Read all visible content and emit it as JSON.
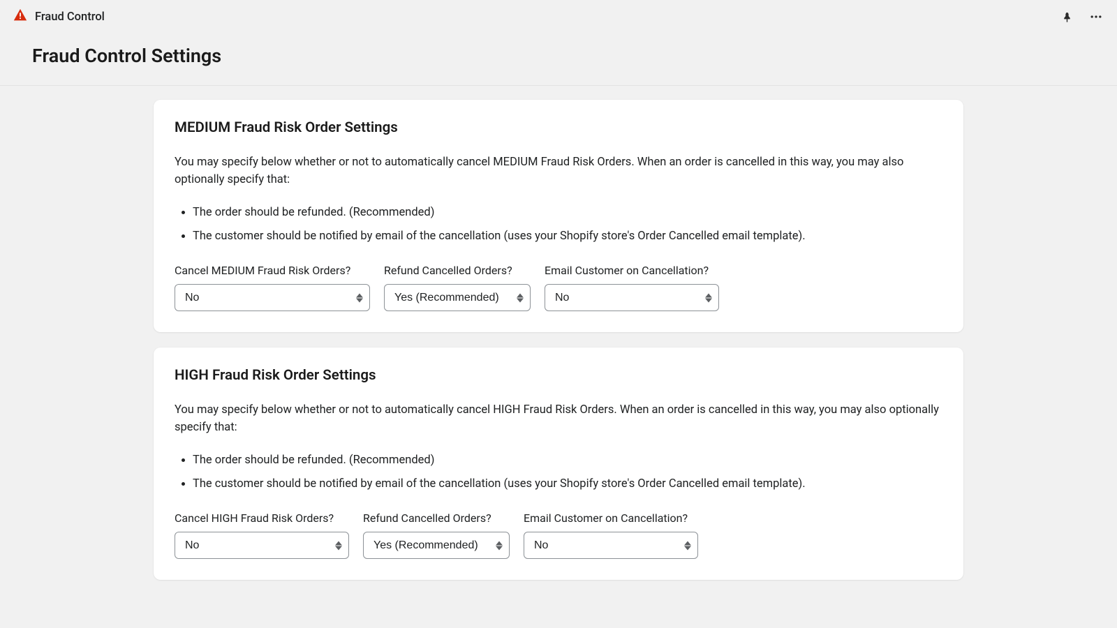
{
  "topbar": {
    "appTitle": "Fraud Control"
  },
  "pageTitle": "Fraud Control Settings",
  "sectionMedium": {
    "title": "MEDIUM Fraud Risk Order Settings",
    "description": "You may specify below whether or not to automatically cancel MEDIUM Fraud Risk Orders. When an order is cancelled in this way, you may also optionally specify that:",
    "bullets": [
      "The order should be refunded. (Recommended)",
      "The customer should be notified by email of the cancellation (uses your Shopify store's Order Cancelled email template)."
    ],
    "controls": {
      "cancel": {
        "label": "Cancel MEDIUM Fraud Risk Orders?",
        "value": "No"
      },
      "refund": {
        "label": "Refund Cancelled Orders?",
        "value": "Yes (Recommended)"
      },
      "email": {
        "label": "Email Customer on Cancellation?",
        "value": "No"
      }
    }
  },
  "sectionHigh": {
    "title": "HIGH Fraud Risk Order Settings",
    "description": "You may specify below whether or not to automatically cancel HIGH Fraud Risk Orders. When an order is cancelled in this way, you may also optionally specify that:",
    "bullets": [
      "The order should be refunded. (Recommended)",
      "The customer should be notified by email of the cancellation (uses your Shopify store's Order Cancelled email template)."
    ],
    "controls": {
      "cancel": {
        "label": "Cancel HIGH Fraud Risk Orders?",
        "value": "No"
      },
      "refund": {
        "label": "Refund Cancelled Orders?",
        "value": "Yes (Recommended)"
      },
      "email": {
        "label": "Email Customer on Cancellation?",
        "value": "No"
      }
    }
  }
}
